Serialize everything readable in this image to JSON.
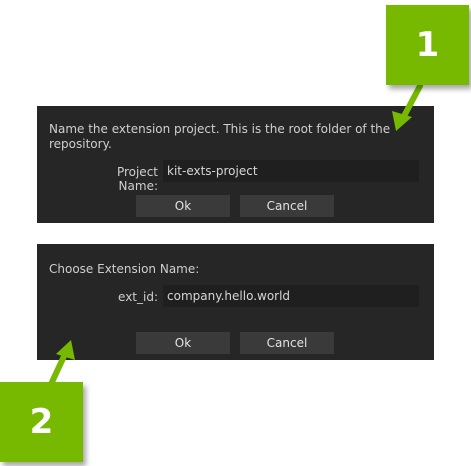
{
  "dialog_project": {
    "prompt": "Name the extension project. This is the root folder of the repository.",
    "field_label": "Project Name:",
    "field_value": "kit-exts-project",
    "ok_label": "Ok",
    "cancel_label": "Cancel"
  },
  "dialog_name": {
    "prompt": "Choose Extension Name:",
    "field_label": "ext_id:",
    "field_value": "company.hello.world",
    "ok_label": "Ok",
    "cancel_label": "Cancel"
  },
  "callouts": {
    "first": "1",
    "second": "2"
  },
  "colors": {
    "accent": "#76b900",
    "dialog_bg": "#262626",
    "input_bg": "#1f1f1f",
    "button_bg": "#3a3a3a",
    "text": "#cfcfcf"
  }
}
